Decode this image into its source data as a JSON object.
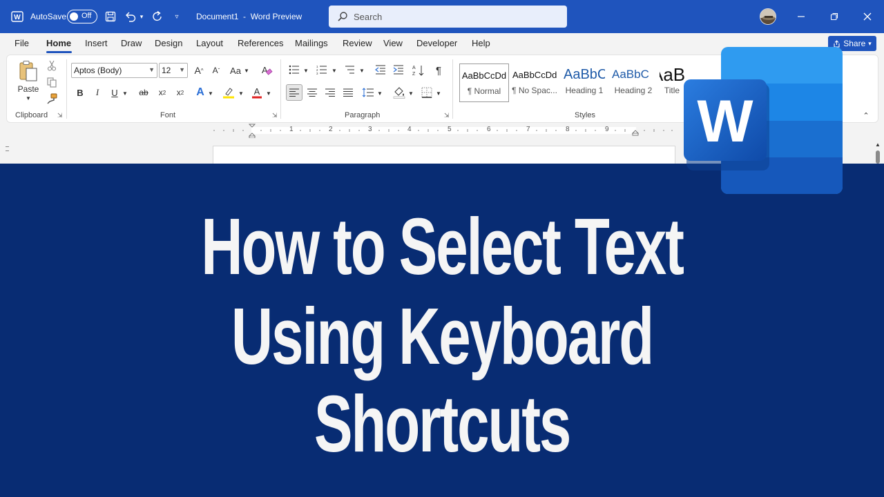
{
  "titlebar": {
    "app_icon": "word-app-icon",
    "autosave_label": "AutoSave",
    "autosave_state": "Off",
    "document_title": "Document1  -  Word Preview",
    "search_placeholder": "Search"
  },
  "menu": {
    "tabs": [
      "File",
      "Home",
      "Insert",
      "Draw",
      "Design",
      "Layout",
      "References",
      "Mailings",
      "Review",
      "View",
      "Developer",
      "Help"
    ],
    "active_tab": "Home",
    "share_label": "Share"
  },
  "ribbon": {
    "clipboard": {
      "paste_label": "Paste",
      "group_label": "Clipboard"
    },
    "font": {
      "font_name": "Aptos (Body)",
      "font_size": "12",
      "case_label": "Aa",
      "group_label": "Font"
    },
    "paragraph": {
      "group_label": "Paragraph"
    },
    "styles": {
      "group_label": "Styles",
      "items": [
        {
          "sample": "AaBbCcDd",
          "name": "¶ Normal"
        },
        {
          "sample": "AaBbCcDd",
          "name": "¶ No Spac..."
        },
        {
          "sample": "AaBbC",
          "name": "Heading 1"
        },
        {
          "sample": "AaBbC",
          "name": "Heading 2"
        },
        {
          "sample": "AaB",
          "name": "Title"
        }
      ]
    }
  },
  "ruler": {
    "numbers": [
      "1",
      "2",
      "3",
      "4",
      "5",
      "6",
      "7",
      "8",
      "9"
    ]
  },
  "banner": {
    "line1": "How to Select Text",
    "line2": "Using Keyboard",
    "line3": "Shortcuts"
  },
  "logo": {
    "letter": "W"
  },
  "colors": {
    "titlebar": "#1f54bd",
    "banner": "#082c73",
    "accent": "#185abd"
  }
}
